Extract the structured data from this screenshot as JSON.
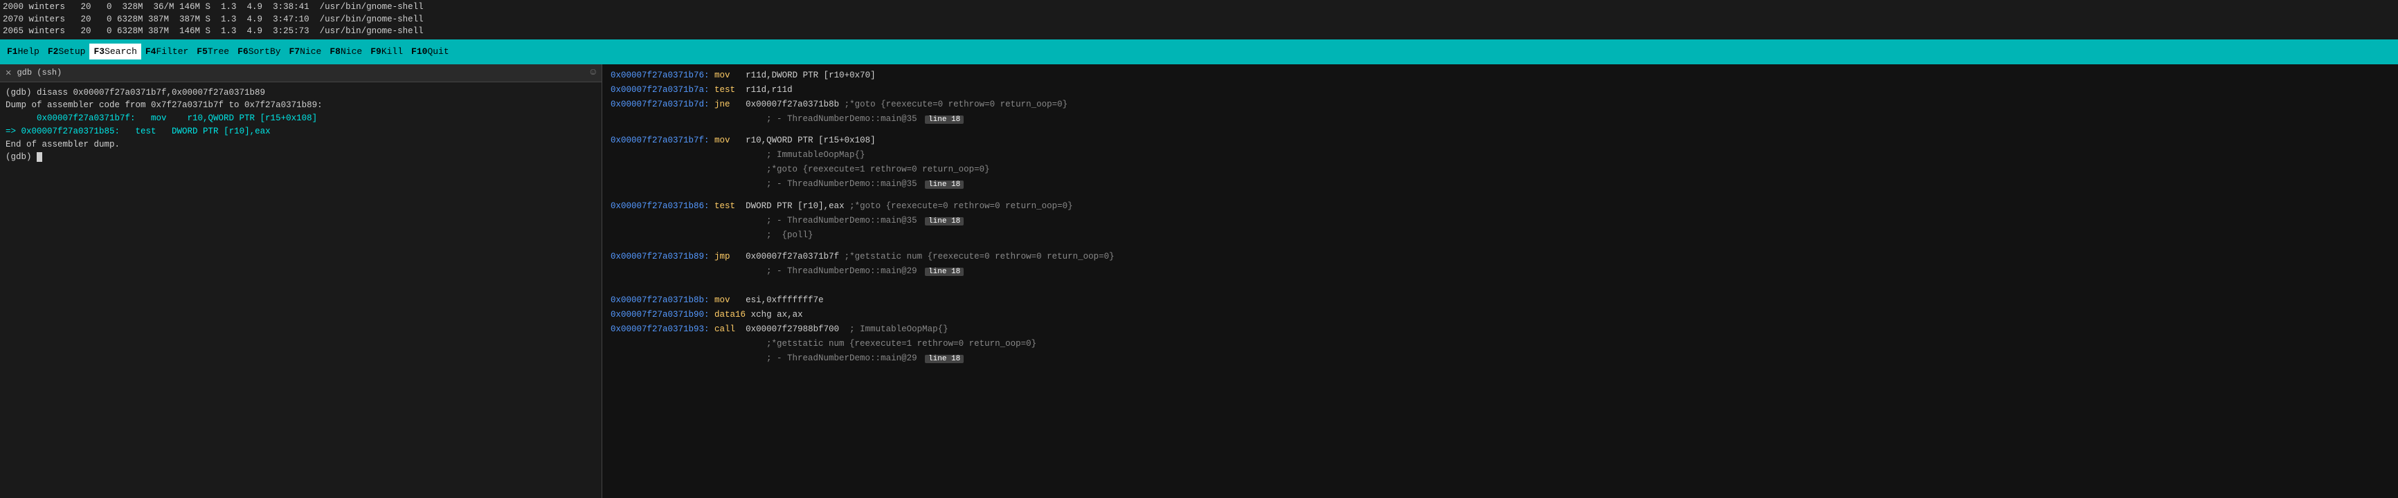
{
  "process_rows": [
    "2000 winters   20   0  328M  36/M 146M S  1.3  4.9  3:38:41  /usr/bin/gnome-shell",
    "2070 winters   20   0 6328M 387M  387M S  1.3  4.9  3:47:10  /usr/bin/gnome-shell",
    "2065 winters   20   0 6328M 387M  146M S  1.3  4.9  3:25:73  /usr/bin/gnome-shell"
  ],
  "menu": {
    "items": [
      {
        "key": "F1",
        "label": "Help"
      },
      {
        "key": "F2",
        "label": "Setup"
      },
      {
        "key": "F3",
        "label": "Search"
      },
      {
        "key": "F4",
        "label": "Filter"
      },
      {
        "key": "F5",
        "label": "Tree"
      },
      {
        "key": "F6",
        "label": "SortBy"
      },
      {
        "key": "F7",
        "label": "Nice"
      },
      {
        "key": "F8",
        "label": "Nice"
      },
      {
        "key": "F9",
        "label": "Kill"
      },
      {
        "key": "F10",
        "label": "Quit"
      }
    ]
  },
  "left_panel": {
    "title": "gdb (ssh)",
    "lines": [
      {
        "type": "normal",
        "text": "(gdb) disass 0x00007f27a0371b7f,0x00007f27a0371b89"
      },
      {
        "type": "normal",
        "text": "Dump of assembler code from 0x7f27a0371b7f to 0x7f27a0371b89:"
      },
      {
        "type": "cyan",
        "text": "   0x00007f27a0371b7f:   mov    r10,QWORD PTR [r15+0x108]"
      },
      {
        "type": "arrow",
        "text": "0x00007f27a0371b85:   test   DWORD PTR [r10],eax"
      },
      {
        "type": "normal",
        "text": "End of assembler dump."
      },
      {
        "type": "prompt",
        "text": "(gdb) "
      }
    ]
  },
  "right_panel": {
    "disasm_blocks": [
      {
        "lines": [
          {
            "addr": "0x00007f27a0371b76:",
            "mnemonic": "mov",
            "operands": "   r11d,DWORD PTR [r10+0x70]",
            "comment": ""
          },
          {
            "addr": "0x00007f27a0371b7a:",
            "mnemonic": "test",
            "operands": "  r11d,r11d",
            "comment": ""
          },
          {
            "addr": "0x00007f27a0371b7d:",
            "mnemonic": "jne",
            "operands": "   0x00007f27a0371b8b",
            "comment": " ;*goto {reexecute=0 rethrow=0 return_oop=0}"
          },
          {
            "addr": "",
            "mnemonic": "",
            "operands": "",
            "comment": "                              ; - ThreadNumberDemo::main@35 (line 18)",
            "badge": "line 18"
          }
        ]
      },
      {
        "blank": true
      },
      {
        "lines": [
          {
            "addr": "0x00007f27a0371b7f:",
            "mnemonic": "mov",
            "operands": "   r10,QWORD PTR [r15+0x108]",
            "comment": ""
          },
          {
            "addr": "",
            "mnemonic": "",
            "operands": "",
            "comment": "                              ; ImmutableOopMap{}"
          },
          {
            "addr": "",
            "mnemonic": "",
            "operands": "",
            "comment": "                              ;*goto {reexecute=1 rethrow=0 return_oop=0}"
          },
          {
            "addr": "",
            "mnemonic": "",
            "operands": "",
            "comment": "                              ; - ThreadNumberDemo::main@35 (line 18)",
            "badge": "line 18"
          }
        ]
      },
      {
        "blank": true
      },
      {
        "lines": [
          {
            "addr": "0x00007f27a0371b86:",
            "mnemonic": "test",
            "operands": "  DWORD PTR [r10],eax",
            "comment": " ;*goto {reexecute=0 rethrow=0 return_oop=0}"
          },
          {
            "addr": "",
            "mnemonic": "",
            "operands": "",
            "comment": "                              ; - ThreadNumberDemo::main@35 (line 18)",
            "badge": "line 18"
          },
          {
            "addr": "",
            "mnemonic": "",
            "operands": "",
            "comment": "                              ;  {poll}"
          }
        ]
      },
      {
        "blank": true
      },
      {
        "lines": [
          {
            "addr": "0x00007f27a0371b89:",
            "mnemonic": "jmp",
            "operands": "   0x00007f27a0371b7f",
            "comment": " ;*getstatic num {reexecute=0 rethrow=0 return_oop=0}"
          },
          {
            "addr": "",
            "mnemonic": "",
            "operands": "",
            "comment": "                              ; - ThreadNumberDemo::main@29 (line 18)",
            "badge": "line 18"
          }
        ]
      },
      {
        "blank": true
      },
      {
        "blank": true
      },
      {
        "lines": [
          {
            "addr": "0x00007f27a0371b8b:",
            "mnemonic": "mov",
            "operands": "   esi,0xfffffff7e",
            "comment": ""
          },
          {
            "addr": "0x00007f27a0371b90:",
            "mnemonic": "data16",
            "operands": " xchg ax,ax",
            "comment": ""
          },
          {
            "addr": "0x00007f27a0371b93:",
            "mnemonic": "call",
            "operands": "  0x00007f27988bf700",
            "comment": "  ; ImmutableOopMap{}"
          },
          {
            "addr": "",
            "mnemonic": "",
            "operands": "",
            "comment": "                              ;*getstatic num {reexecute=1 rethrow=0 return_oop=0}"
          },
          {
            "addr": "",
            "mnemonic": "",
            "operands": "",
            "comment": "                              ; - ThreadNumberDemo::main@29 (line 18)",
            "badge": "line 18"
          }
        ]
      }
    ]
  }
}
